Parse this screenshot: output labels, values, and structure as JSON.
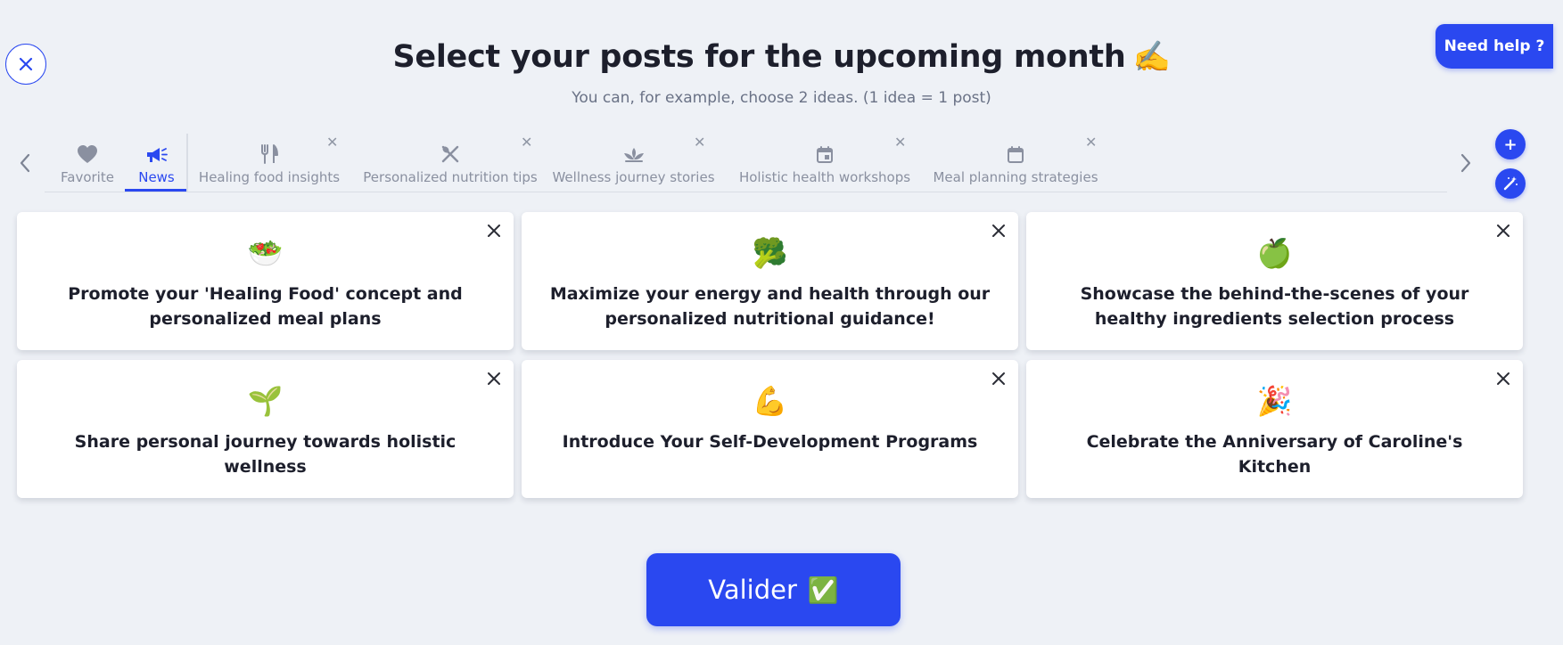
{
  "header": {
    "title": "Select your posts for the upcoming month",
    "title_emoji": "✍️",
    "subtitle": "You can, for example, choose 2 ideas. (1 idea = 1 post)",
    "help_label": "Need help ?"
  },
  "tabs": [
    {
      "label": "Favorite",
      "icon": "heart-icon",
      "active": false,
      "removable": false
    },
    {
      "label": "News",
      "icon": "megaphone-icon",
      "active": true,
      "removable": false
    },
    {
      "label": "Healing food insights",
      "icon": "fork-knife-icon",
      "active": false,
      "removable": true
    },
    {
      "label": "Personalized nutrition tips",
      "icon": "crossed-utensils-icon",
      "active": false,
      "removable": true
    },
    {
      "label": "Wellness journey stories",
      "icon": "lotus-icon",
      "active": false,
      "removable": true
    },
    {
      "label": "Holistic health workshops",
      "icon": "calendar-event-icon",
      "active": false,
      "removable": true
    },
    {
      "label": "Meal planning strategies",
      "icon": "calendar-icon",
      "active": false,
      "removable": true
    }
  ],
  "ideas": [
    {
      "emoji": "🥗",
      "text": "Promote your 'Healing Food' concept and personalized meal plans"
    },
    {
      "emoji": "🥦",
      "text": "Maximize your energy and health through our personalized nutritional guidance!"
    },
    {
      "emoji": "🍏",
      "text": "Showcase the behind-the-scenes of your healthy ingredients selection process"
    },
    {
      "emoji": "🌱",
      "text": "Share personal journey towards holistic wellness"
    },
    {
      "emoji": "💪",
      "text": "Introduce Your Self-Development Programs"
    },
    {
      "emoji": "🎉",
      "text": "Celebrate the Anniversary of Caroline's Kitchen"
    }
  ],
  "footer": {
    "validate_label": "Valider",
    "validate_emoji": "✅"
  },
  "colors": {
    "accent": "#2a48f0",
    "background": "#eef1f6",
    "muted_text": "#8a90a0"
  }
}
